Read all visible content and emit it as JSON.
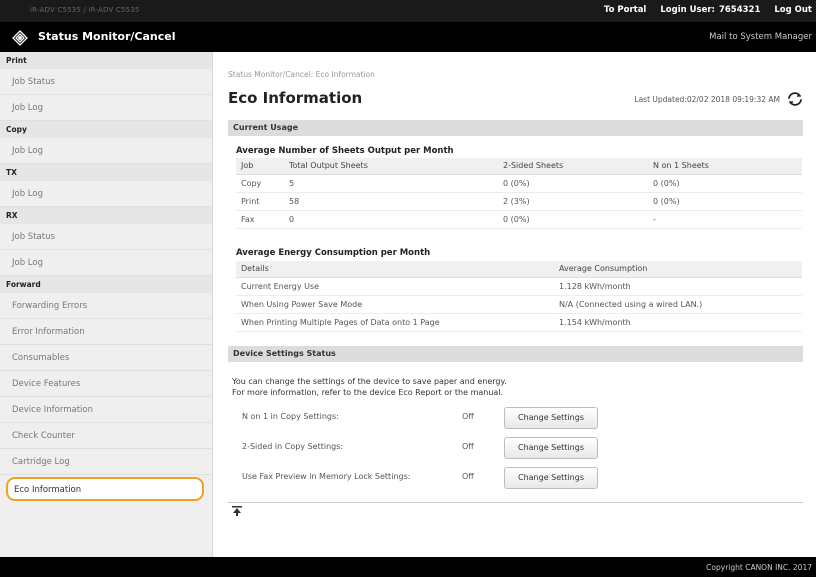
{
  "topbar": {
    "device": "iR-ADV C5535 / iR-ADV C5535",
    "to_portal": "To Portal",
    "login_label": "Login User:",
    "login_user": "7654321",
    "logout": "Log Out"
  },
  "header": {
    "title": "Status Monitor/Cancel",
    "mail_link": "Mail to System Manager"
  },
  "sidebar": {
    "print_cat": "Print",
    "print_items": [
      "Job Status",
      "Job Log"
    ],
    "copy_cat": "Copy",
    "copy_items": [
      "Job Log"
    ],
    "tx_cat": "TX",
    "tx_items": [
      "Job Log"
    ],
    "rx_cat": "RX",
    "rx_items": [
      "Job Status",
      "Job Log"
    ],
    "forward_cat": "Forward",
    "forward_items": [
      "Forwarding Errors"
    ],
    "misc_items": [
      "Error Information",
      "Consumables",
      "Device Features",
      "Device Information",
      "Check Counter",
      "Cartridge Log",
      "Eco Information"
    ]
  },
  "main": {
    "breadcrumb": "Status Monitor/Cancel: Eco Information",
    "title": "Eco Information",
    "last_updated": "Last Updated:02/02 2018 09:19:32 AM",
    "current_usage": "Current Usage",
    "sheets_heading": "Average Number of Sheets Output per Month",
    "sheets_headers": [
      "Job",
      "Total Output Sheets",
      "2-Sided Sheets",
      "N on 1 Sheets"
    ],
    "sheets_rows": [
      [
        "Copy",
        "5",
        "0 (0%)",
        "0 (0%)"
      ],
      [
        "Print",
        "58",
        "2 (3%)",
        "0 (0%)"
      ],
      [
        "Fax",
        "0",
        "0 (0%)",
        "-"
      ]
    ],
    "energy_heading": "Average Energy Consumption per Month",
    "energy_headers": [
      "Details",
      "Average Consumption"
    ],
    "energy_rows": [
      [
        "Current Energy Use",
        "1.128 kWh/month"
      ],
      [
        "When Using Power Save Mode",
        "N/A (Connected using a wired LAN.)"
      ],
      [
        "When Printing Multiple Pages of Data onto 1 Page",
        "1.154 kWh/month"
      ]
    ],
    "device_settings": "Device Settings Status",
    "desc_line1": "You can change the settings of the device to save paper and energy.",
    "desc_line2": "For more information, refer to the device Eco Report or the manual.",
    "settings": [
      {
        "label": "N on 1 in Copy Settings:",
        "value": "Off",
        "button": "Change Settings"
      },
      {
        "label": "2-Sided in Copy Settings:",
        "value": "Off",
        "button": "Change Settings"
      },
      {
        "label": "Use Fax Preview in Memory Lock Settings:",
        "value": "Off",
        "button": "Change Settings"
      }
    ]
  },
  "footer": {
    "copyright": "Copyright CANON INC. 2017"
  },
  "colors": {
    "accent_highlight": "#f4a020",
    "header_bg": "#000000",
    "section_bg": "#dcdcdc"
  }
}
